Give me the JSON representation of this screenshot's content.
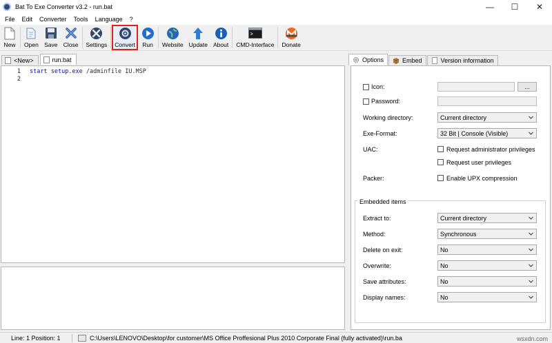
{
  "window": {
    "title": "Bat To Exe Converter v3.2 - run.bat",
    "controls": {
      "minimize": "—",
      "maximize": "☐",
      "close": "✕"
    }
  },
  "menu": [
    "File",
    "Edit",
    "Converter",
    "Tools",
    "Language",
    "?"
  ],
  "toolbar": {
    "highlight_color": "#e0201b",
    "buttons": [
      {
        "label": "New",
        "icon": "new-file-icon"
      },
      {
        "label": "Open",
        "icon": "open-icon"
      },
      {
        "label": "Save",
        "icon": "save-icon"
      },
      {
        "label": "Close",
        "icon": "close-x-icon"
      },
      {
        "label": "Settings",
        "icon": "settings-icon"
      },
      {
        "label": "Convert",
        "icon": "convert-icon"
      },
      {
        "label": "Run",
        "icon": "run-icon"
      },
      {
        "label": "Website",
        "icon": "globe-icon"
      },
      {
        "label": "Update",
        "icon": "update-arrow-icon"
      },
      {
        "label": "About",
        "icon": "info-icon"
      },
      {
        "label": "CMD-Interface",
        "icon": "terminal-icon"
      },
      {
        "label": "Donate",
        "icon": "monero-icon"
      }
    ]
  },
  "editor_tabs": [
    "<New>",
    "run.bat"
  ],
  "editor": {
    "lines": [
      {
        "number": "1",
        "keyword": "start",
        "command": "setup.exe",
        "args": " /adminfile IU.MSP"
      },
      {
        "number": "2",
        "keyword": "",
        "command": "",
        "args": ""
      }
    ]
  },
  "right_tabs": [
    {
      "label": "Options",
      "icon": "gear-icon"
    },
    {
      "label": "Embed",
      "icon": "box-icon"
    },
    {
      "label": "Version information",
      "icon": "doc-icon"
    }
  ],
  "options": {
    "icon_label": "Icon:",
    "browse_label": "...",
    "password_label": "Password:",
    "working_directory_label": "Working directory:",
    "working_directory_value": "Current directory",
    "exe_format_label": "Exe-Format:",
    "exe_format_value": "32 Bit | Console (Visible)",
    "uac_label": "UAC:",
    "uac_admin_label": "Request administrator privileges",
    "uac_user_label": "Request user privileges",
    "packer_label": "Packer:",
    "packer_upx_label": "Enable UPX compression"
  },
  "embedded": {
    "group_title": "Embedded items",
    "extract_to_label": "Extract to:",
    "extract_to_value": "Current directory",
    "method_label": "Method:",
    "method_value": "Synchronous",
    "delete_on_exit_label": "Delete on exit:",
    "delete_on_exit_value": "No",
    "overwrite_label": "Overwrite:",
    "overwrite_value": "No",
    "save_attributes_label": "Save attributes:",
    "save_attributes_value": "No",
    "display_names_label": "Display names:",
    "display_names_value": "No"
  },
  "status": {
    "position": "Line: 1  Position: 1",
    "path": "C:\\Users\\LENOVO\\Desktop\\for customer\\MS Office Proffesional Plus 2010 Corporate Final (fully activated)\\run.ba"
  },
  "watermark": "wsxdn.com"
}
